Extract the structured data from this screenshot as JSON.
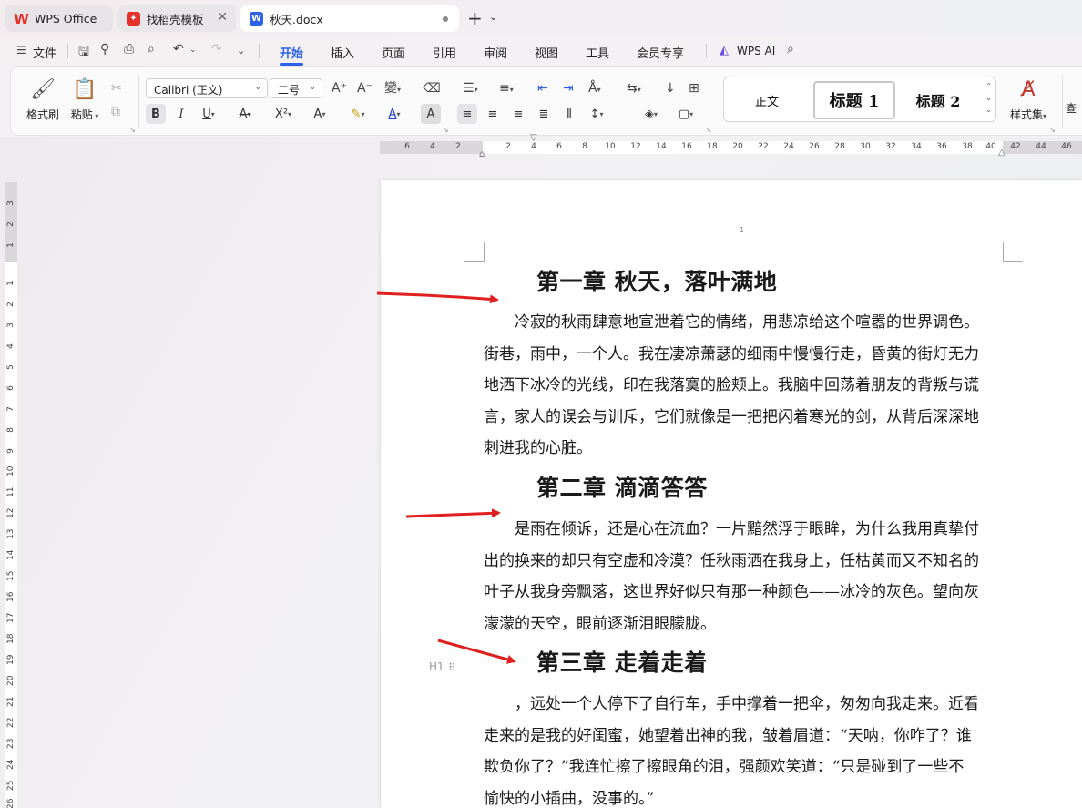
{
  "tabs": [
    {
      "label": "WPS Office",
      "icon": "wps-logo-icon"
    },
    {
      "label": "找稻壳模板",
      "icon": "docer-icon"
    },
    {
      "label": "秋天.docx",
      "icon": "word-doc-icon"
    }
  ],
  "menu": {
    "file": "文件",
    "items": [
      "开始",
      "插入",
      "页面",
      "引用",
      "审阅",
      "视图",
      "工具",
      "会员专享"
    ],
    "active": "开始",
    "wps_ai": "WPS AI"
  },
  "ribbon": {
    "format_painter": "格式刷",
    "paste": "粘贴",
    "font_name": "Calibri (正文)",
    "font_size": "二号",
    "styles": {
      "normal": "正文",
      "h1": "标题 1",
      "h2": "标题 2"
    },
    "style_set": "样式集",
    "cut_partial": "查"
  },
  "rulers": {
    "h_left": [
      "6",
      "4",
      "2"
    ],
    "h_right": [
      "2",
      "4",
      "6",
      "8",
      "10",
      "12",
      "14",
      "16",
      "18",
      "20",
      "22",
      "24",
      "26",
      "28",
      "30",
      "32",
      "34",
      "36",
      "38",
      "40",
      "42",
      "44",
      "46"
    ],
    "v_top": [
      "3",
      "2",
      "1"
    ],
    "v_main": [
      "1",
      "2",
      "3",
      "4",
      "5",
      "6",
      "7",
      "8",
      "9",
      "10",
      "11",
      "12",
      "13",
      "14",
      "15",
      "16",
      "17",
      "18",
      "19",
      "20",
      "21",
      "22",
      "23",
      "24",
      "25",
      "26"
    ]
  },
  "document": {
    "page_number": "1",
    "sections": [
      {
        "heading": "第一章  秋天，落叶满地",
        "lines": [
          "冷寂的秋雨肆意地宣泄着它的情绪，用悲凉给这个喧嚣的世界调色。",
          "街巷，雨中，一个人。我在凄凉萧瑟的细雨中慢慢行走，昏黄的街灯无力",
          "地洒下冰冷的光线，印在我落寞的脸颊上。我脑中回荡着朋友的背叛与谎",
          "言，家人的误会与训斥，它们就像是一把把闪着寒光的剑，从背后深深地",
          "刺进我的心脏。"
        ]
      },
      {
        "heading": "第二章  滴滴答答",
        "lines": [
          "是雨在倾诉，还是心在流血？一片黯然浮于眼眸，为什么我用真挚付",
          "出的换来的却只有空虚和冷漠？任秋雨洒在我身上，任枯黄而又不知名的",
          "叶子从我身旁飘落，这世界好似只有那一种颜色——冰冷的灰色。望向灰",
          "濛濛的天空，眼前逐渐泪眼朦胧。"
        ]
      },
      {
        "heading": "第三章  走着走着",
        "lines": [
          "，远处一个人停下了自行车，手中撑着一把伞，匆匆向我走来。近看",
          "走来的是我的好闺蜜，她望着出神的我，皱着眉道：“天呐，你咋了？谁",
          "欺负你了？”我连忙擦了擦眼角的泪，强颜欢笑道：“只是碰到了一些不",
          "愉快的小插曲，没事的。”"
        ]
      }
    ],
    "heading_marker": "H1"
  },
  "colors": {
    "accent": "#2b62e8",
    "arrow": "#e02020",
    "wps_red": "#e4312b"
  }
}
